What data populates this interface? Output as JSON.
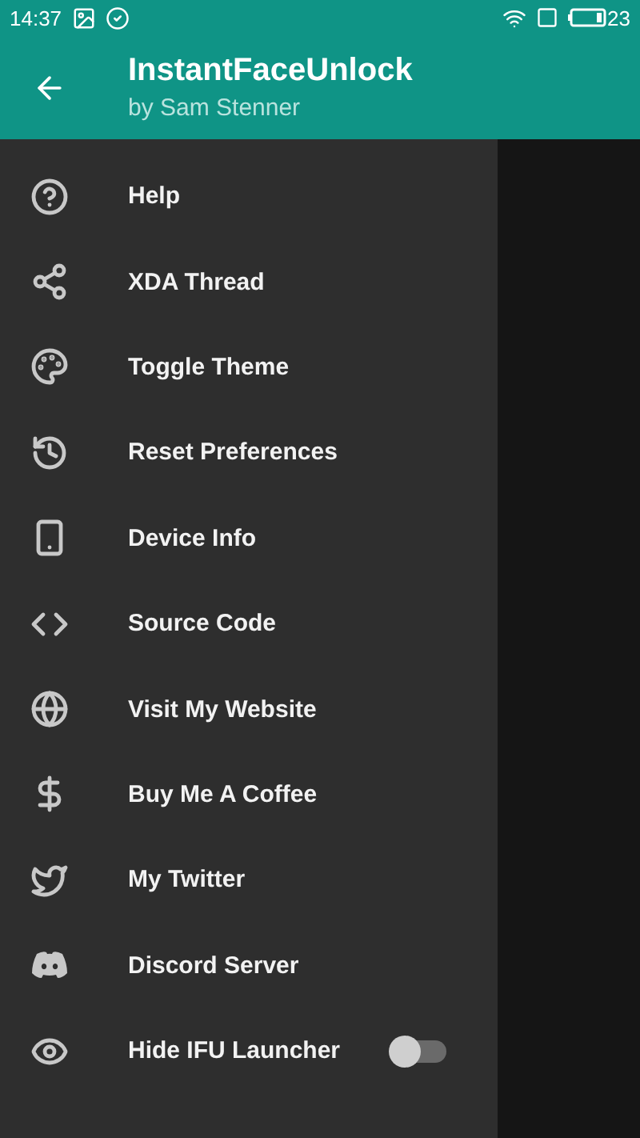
{
  "status_bar": {
    "time": "14:37",
    "battery": "23"
  },
  "app_bar": {
    "title": "InstantFaceUnlock",
    "subtitle": "by Sam Stenner"
  },
  "drawer": {
    "items": [
      {
        "kind": "link",
        "label": "Help"
      },
      {
        "kind": "link",
        "label": "XDA Thread"
      },
      {
        "kind": "link",
        "label": "Toggle Theme"
      },
      {
        "kind": "link",
        "label": "Reset Preferences"
      },
      {
        "kind": "link",
        "label": "Device Info"
      },
      {
        "kind": "link",
        "label": "Source Code"
      },
      {
        "kind": "link",
        "label": "Visit My Website"
      },
      {
        "kind": "link",
        "label": "Buy Me A Coffee"
      },
      {
        "kind": "link",
        "label": "My Twitter"
      },
      {
        "kind": "link",
        "label": "Discord Server"
      },
      {
        "kind": "switch",
        "label": "Hide IFU Launcher",
        "on": false
      }
    ]
  }
}
